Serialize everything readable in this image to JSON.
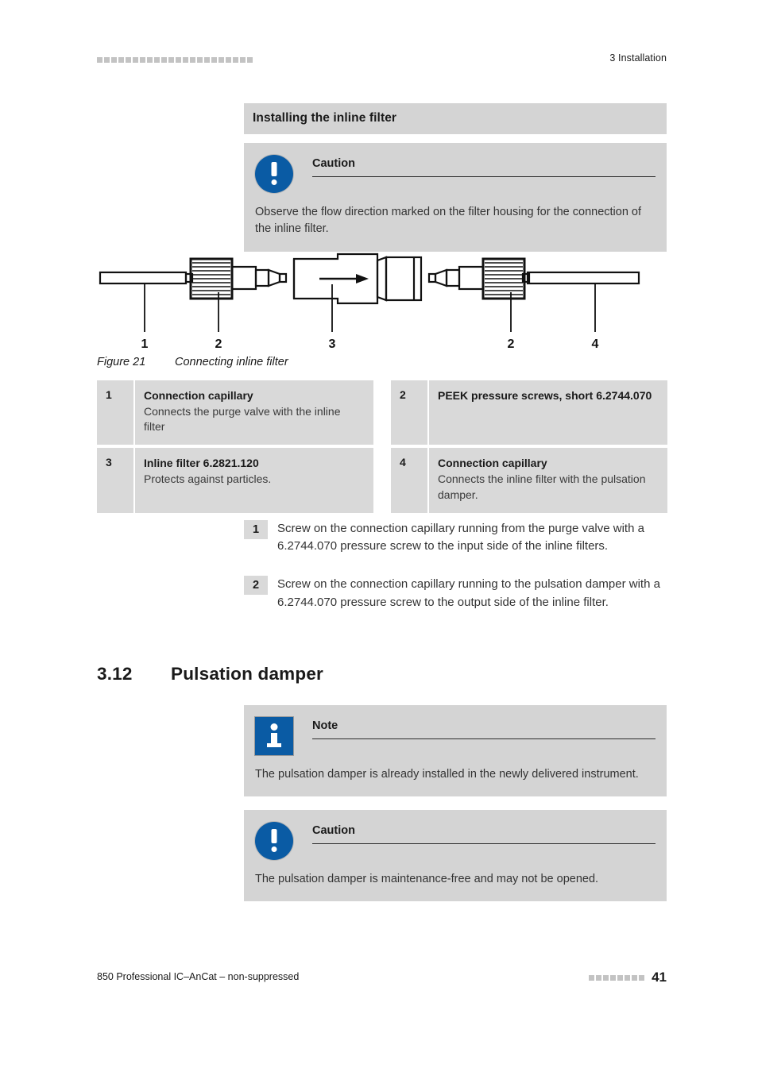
{
  "header": {
    "running_head": "3 Installation",
    "dot_count": 22
  },
  "section_heading": "Installing the inline filter",
  "caution_top": {
    "icon": "caution-exclamation-icon",
    "title": "Caution",
    "body": "Observe the flow direction marked on the filter housing for the connection of the inline filter."
  },
  "figure": {
    "caption_label": "Figure 21",
    "caption_text": "Connecting inline filter",
    "callouts": [
      "1",
      "2",
      "3",
      "2",
      "4"
    ],
    "flow_arrow": "flow-direction-arrow"
  },
  "legend": [
    {
      "num": "1",
      "title": "Connection capillary",
      "desc": "Connects the purge valve with the inline filter"
    },
    {
      "num": "2",
      "title": "PEEK pressure screws, short 6.2744.070",
      "desc": ""
    },
    {
      "num": "3",
      "title": "Inline filter 6.2821.120",
      "desc": "Protects against particles."
    },
    {
      "num": "4",
      "title": "Connection capillary",
      "desc": "Connects the inline filter with the pulsation damper."
    }
  ],
  "steps": [
    {
      "num": "1",
      "text": "Screw on the connection capillary running from the purge valve with a 6.2744.070 pressure screw to the input side of the inline filters."
    },
    {
      "num": "2",
      "text": "Screw on the connection capillary running to the pulsation damper with a 6.2744.070 pressure screw to the output side of the inline filter."
    }
  ],
  "chapter": {
    "number": "3.12",
    "title": "Pulsation damper"
  },
  "note": {
    "icon": "info-icon",
    "title": "Note",
    "body": "The pulsation damper is already installed in the newly delivered instrument."
  },
  "caution_bottom": {
    "icon": "caution-exclamation-icon",
    "title": "Caution",
    "body": "The pulsation damper is maintenance-free and may not be opened."
  },
  "footer": {
    "text": "850 Professional IC–AnCat – non-suppressed",
    "page_number": "41",
    "dot_count": 8
  },
  "colors": {
    "panel_grey": "#d4d4d4",
    "table_grey": "#d9d9d9",
    "icon_blue": "#0a5ba4",
    "dot_grey": "#c3c3c3"
  }
}
